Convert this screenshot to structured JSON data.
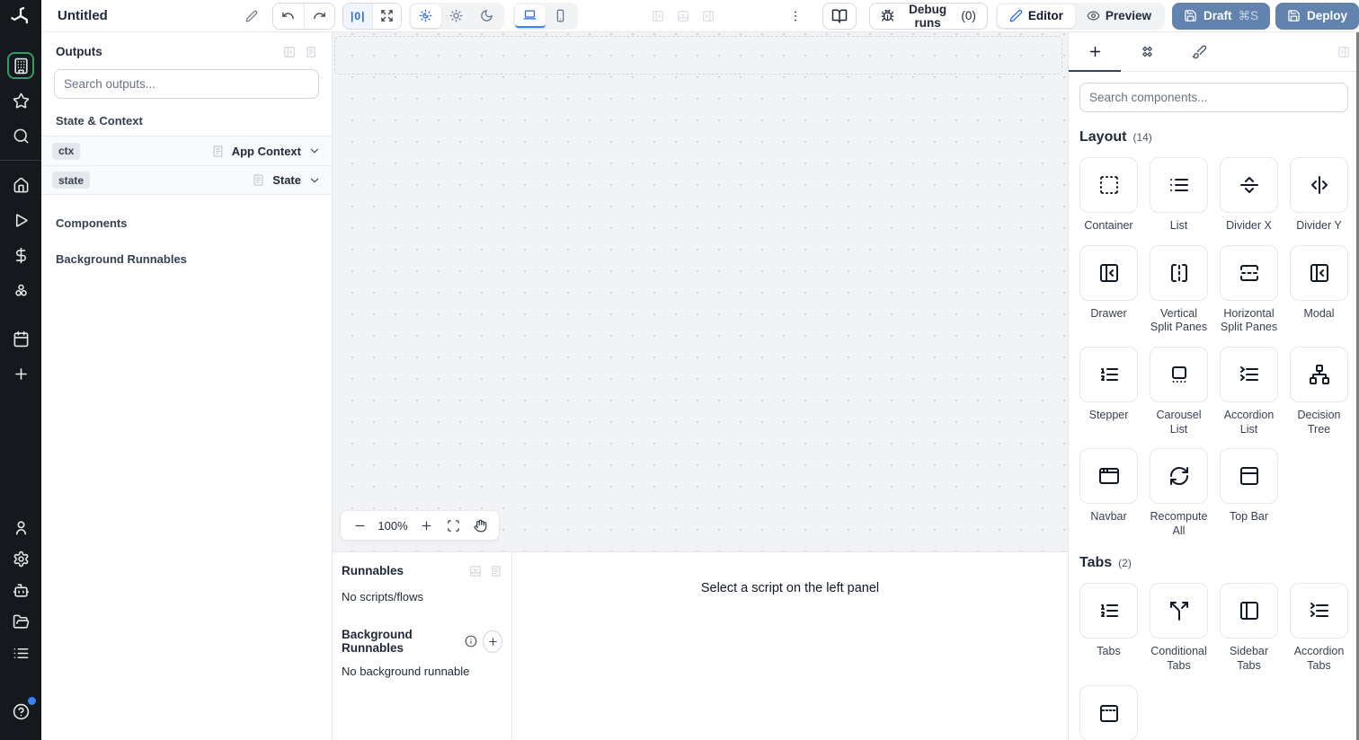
{
  "topbar": {
    "title": "Untitled",
    "zoom_code": "|0|",
    "debug_label": "Debug runs",
    "debug_count": "(0)",
    "editor_label": "Editor",
    "preview_label": "Preview",
    "draft_label": "Draft",
    "draft_shortcut": "⌘S",
    "deploy_label": "Deploy"
  },
  "sidebar": {
    "groups": [
      {
        "divider_after": true,
        "items": [
          {
            "icon": "building",
            "name": "apps",
            "selected": true
          },
          {
            "icon": "star",
            "name": "favorites"
          },
          {
            "icon": "search",
            "name": "search"
          }
        ]
      },
      {
        "items": [
          {
            "icon": "home",
            "name": "home"
          },
          {
            "icon": "play",
            "name": "runs"
          },
          {
            "icon": "dollar",
            "name": "variables"
          },
          {
            "icon": "resources",
            "name": "resources"
          }
        ]
      },
      {
        "gap_before": true,
        "items": [
          {
            "icon": "calendar",
            "name": "schedules"
          },
          {
            "icon": "plus",
            "name": "create"
          }
        ]
      }
    ],
    "bottom_items": [
      {
        "icon": "user",
        "name": "account"
      },
      {
        "icon": "gear",
        "name": "settings"
      },
      {
        "icon": "bot",
        "name": "ai-assistant"
      },
      {
        "icon": "folder",
        "name": "folders"
      },
      {
        "icon": "list",
        "name": "audit-logs"
      },
      {
        "icon": "help",
        "name": "help",
        "badge": true
      }
    ]
  },
  "outputs_panel": {
    "title": "Outputs",
    "search_placeholder": "Search outputs...",
    "state_context_title": "State & Context",
    "rows": [
      {
        "badge": "ctx",
        "type": "App Context"
      },
      {
        "badge": "state",
        "type": "State"
      }
    ],
    "components_title": "Components",
    "background_title": "Background Runnables"
  },
  "canvas": {
    "zoom_level": "100%"
  },
  "runnables_panel": {
    "title": "Runnables",
    "empty_scripts": "No scripts/flows",
    "background_title": "Background Runnables",
    "empty_background": "No background runnable",
    "select_hint": "Select a script on the left panel"
  },
  "right_panel": {
    "search_placeholder": "Search components...",
    "sections": [
      {
        "title": "Layout",
        "count": "(14)",
        "items": [
          {
            "label": "Container",
            "icon": "box-select"
          },
          {
            "label": "List",
            "icon": "list"
          },
          {
            "label": "Divider X",
            "icon": "separator-horizontal"
          },
          {
            "label": "Divider Y",
            "icon": "separator-vertical"
          },
          {
            "label": "Drawer",
            "icon": "panel-left-close"
          },
          {
            "label": "Vertical Split Panes",
            "icon": "split-vertical"
          },
          {
            "label": "Horizontal Split Panes",
            "icon": "split-horizontal"
          },
          {
            "label": "Modal",
            "icon": "panel-left-close"
          },
          {
            "label": "Stepper",
            "icon": "list-ordered"
          },
          {
            "label": "Carousel List",
            "icon": "carousel"
          },
          {
            "label": "Accordion List",
            "icon": "accordion"
          },
          {
            "label": "Decision Tree",
            "icon": "network"
          },
          {
            "label": "Navbar",
            "icon": "app-window"
          },
          {
            "label": "Recompute All",
            "icon": "refresh-cw"
          },
          {
            "label": "Top Bar",
            "icon": "panel-top"
          }
        ]
      },
      {
        "title": "Tabs",
        "count": "(2)",
        "items": [
          {
            "label": "Tabs",
            "icon": "list-ordered"
          },
          {
            "label": "Conditional Tabs",
            "icon": "split"
          },
          {
            "label": "Sidebar Tabs",
            "icon": "panel-left"
          },
          {
            "label": "Accordion Tabs",
            "icon": "accordion"
          },
          {
            "label": "",
            "icon": "invisible-tabs"
          }
        ]
      }
    ]
  },
  "colors": {
    "accent_blue": "#2563eb",
    "action_button": "#6283ae",
    "rail_background": "#15181d",
    "selected_green": "#2f9e63"
  }
}
